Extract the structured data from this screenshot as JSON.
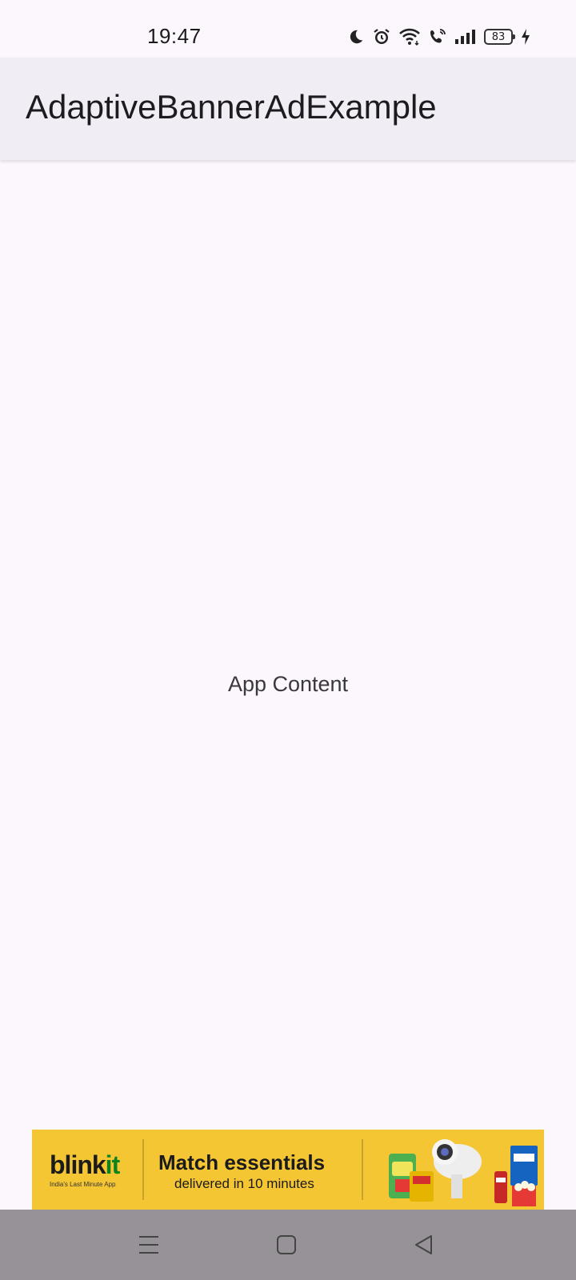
{
  "status_bar": {
    "time": "19:47",
    "battery_level": "83",
    "icons": [
      "moon-icon",
      "alarm-icon",
      "wifi-icon",
      "wifi-call-icon",
      "signal-icon",
      "battery-icon",
      "charging-icon"
    ]
  },
  "app_bar": {
    "title": "AdaptiveBannerAdExample"
  },
  "main": {
    "content_text": "App Content"
  },
  "ad_banner": {
    "brand_prefix": "blink",
    "brand_suffix": "it",
    "tagline": "India's Last Minute App",
    "headline": "Match essentials",
    "subline": "delivered in 10 minutes",
    "background_color": "#f5c634",
    "brand_accent_color": "#0c831f"
  },
  "nav_bar": {
    "buttons": [
      "menu-icon",
      "home-icon",
      "back-icon"
    ]
  }
}
